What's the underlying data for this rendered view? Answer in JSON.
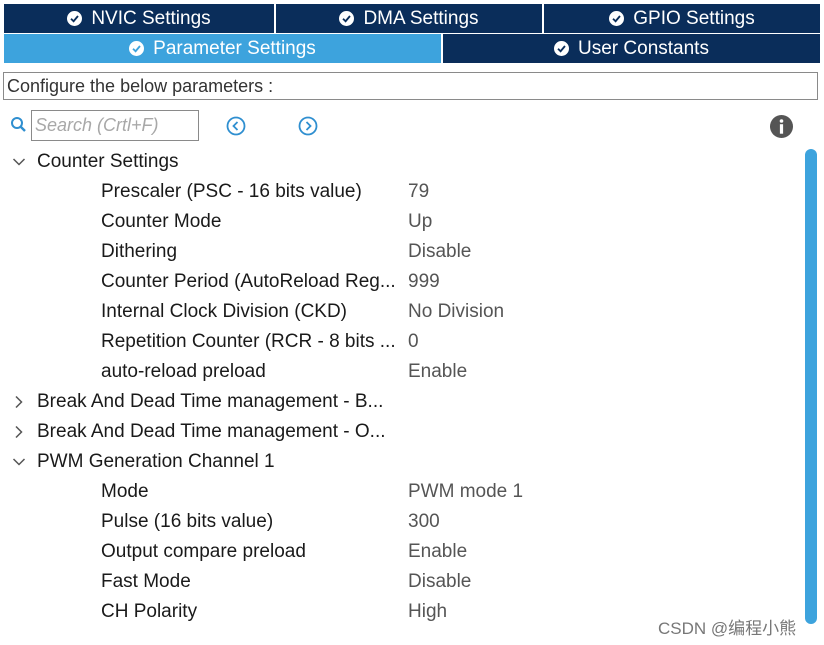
{
  "tabs_row1": [
    {
      "label": "NVIC Settings",
      "active": false
    },
    {
      "label": "DMA Settings",
      "active": false
    },
    {
      "label": "GPIO Settings",
      "active": false
    }
  ],
  "tabs_row2": [
    {
      "label": "Parameter Settings",
      "active": true
    },
    {
      "label": "User Constants",
      "active": false
    }
  ],
  "description": "Configure the below parameters :",
  "search": {
    "placeholder": "Search (Crtl+F)"
  },
  "tree": [
    {
      "type": "group",
      "label": "Counter Settings",
      "expanded": true
    },
    {
      "type": "param",
      "label": "Prescaler (PSC - 16 bits value)",
      "value": "79"
    },
    {
      "type": "param",
      "label": "Counter Mode",
      "value": "Up"
    },
    {
      "type": "param",
      "label": "Dithering",
      "value": "Disable"
    },
    {
      "type": "param",
      "label": "Counter Period (AutoReload Reg...",
      "value": "999"
    },
    {
      "type": "param",
      "label": "Internal Clock Division (CKD)",
      "value": "No Division"
    },
    {
      "type": "param",
      "label": "Repetition Counter (RCR - 8 bits ...",
      "value": "0"
    },
    {
      "type": "param",
      "label": "auto-reload preload",
      "value": "Enable"
    },
    {
      "type": "group",
      "label": "Break And Dead Time management - B...",
      "expanded": false
    },
    {
      "type": "group",
      "label": "Break And Dead Time management - O...",
      "expanded": false
    },
    {
      "type": "group",
      "label": "PWM Generation Channel 1",
      "expanded": true
    },
    {
      "type": "param",
      "label": "Mode",
      "value": "PWM mode 1"
    },
    {
      "type": "param",
      "label": "Pulse (16 bits value)",
      "value": "300"
    },
    {
      "type": "param",
      "label": "Output compare preload",
      "value": "Enable"
    },
    {
      "type": "param",
      "label": "Fast Mode",
      "value": "Disable"
    },
    {
      "type": "param",
      "label": "CH Polarity",
      "value": "High"
    }
  ],
  "watermark": "CSDN @编程小熊",
  "colors": {
    "tab_bg": "#0a2d5a",
    "tab_active": "#3da3dd",
    "scrollbar": "#3da3dd"
  },
  "icons": {
    "tab": "check-circle-icon",
    "search": "search-icon",
    "prev": "circle-arrow-left-icon",
    "next": "circle-arrow-right-icon",
    "info": "info-icon"
  }
}
